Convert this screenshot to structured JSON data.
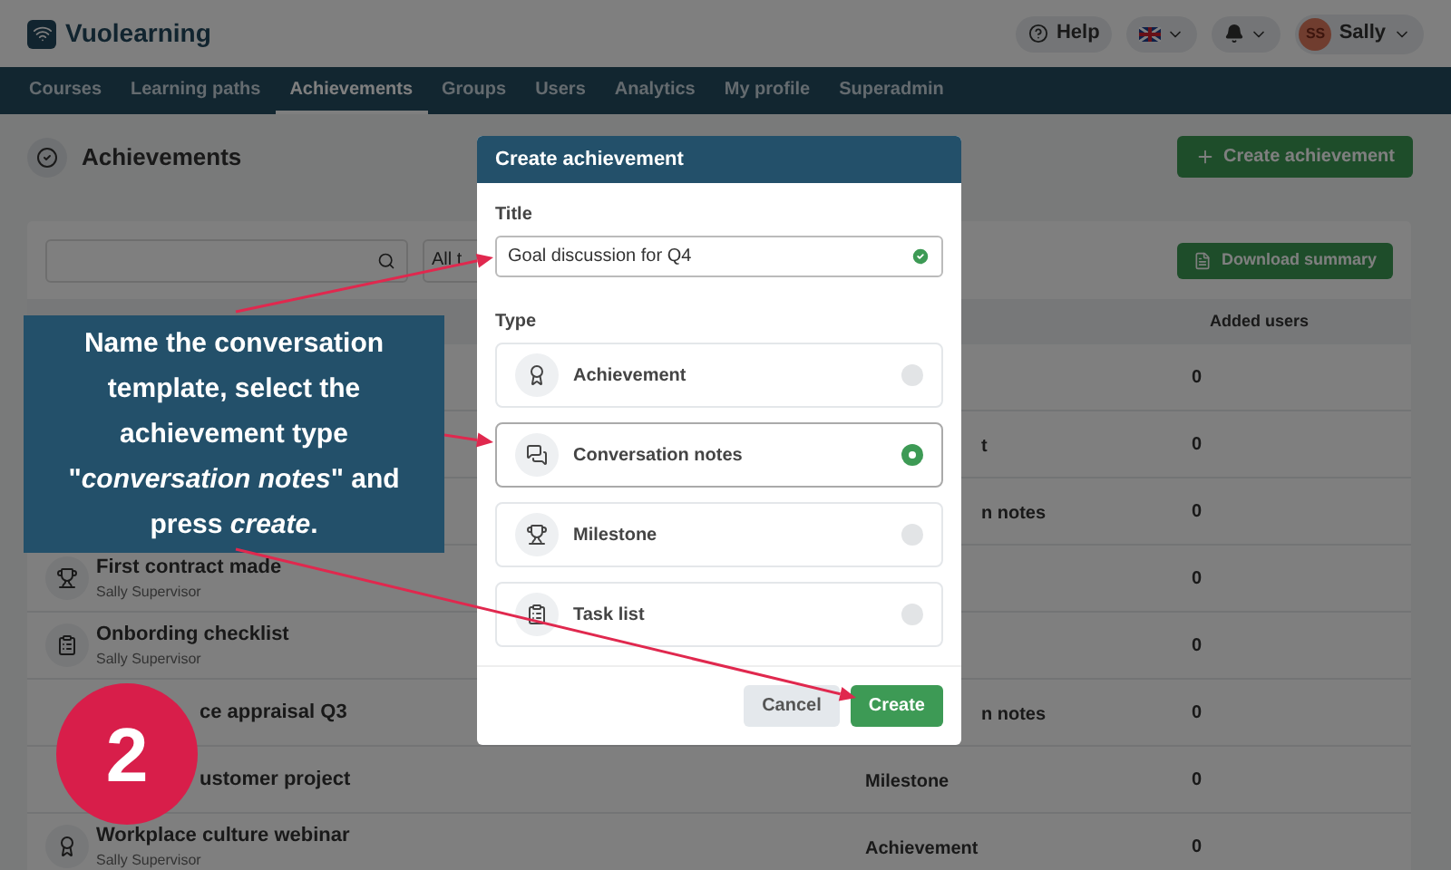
{
  "topbar": {
    "logo": "Vuolearning",
    "help": "Help",
    "user_initials": "SS",
    "user_name": "Sally"
  },
  "nav": [
    {
      "label": "Courses",
      "selected": false
    },
    {
      "label": "Learning paths",
      "selected": false
    },
    {
      "label": "Achievements",
      "selected": true
    },
    {
      "label": "Groups",
      "selected": false
    },
    {
      "label": "Users",
      "selected": false
    },
    {
      "label": "Analytics",
      "selected": false
    },
    {
      "label": "My profile",
      "selected": false
    },
    {
      "label": "Superadmin",
      "selected": false
    }
  ],
  "page": {
    "title": "Achievements",
    "create_button": "Create achievement"
  },
  "toolbar": {
    "type_filter": "All t",
    "download_button": "Download summary"
  },
  "table": {
    "columns": [
      "Added users"
    ],
    "rows": [
      {
        "kind": "blank",
        "users": "0"
      },
      {
        "kind": "blank",
        "type": "t",
        "type_cut": true,
        "users": "0"
      },
      {
        "kind": "blank",
        "type": "n notes",
        "type_cut": true,
        "users": "0"
      },
      {
        "kind": "trophy",
        "name": "First contract made",
        "owner": "Sally Supervisor",
        "users": "0"
      },
      {
        "kind": "clipboard",
        "name": "Onbording checklist",
        "owner": "Sally Supervisor",
        "users": "0"
      },
      {
        "kind": "cut",
        "name": "ce appraisal Q3",
        "type": "n notes",
        "type_cut": true,
        "users": "0"
      },
      {
        "kind": "cut",
        "name": "ustomer project",
        "type": "Milestone",
        "users": "0"
      },
      {
        "kind": "award",
        "name": "Workplace culture webinar",
        "owner": "Sally Supervisor",
        "type": "Achievement",
        "users": "0"
      }
    ]
  },
  "modal": {
    "title": "Create achievement",
    "title_label": "Title",
    "title_value": "Goal discussion for Q4",
    "title_valid": true,
    "type_label": "Type",
    "options": [
      {
        "kind": "award",
        "label": "Achievement",
        "selected": false
      },
      {
        "kind": "chat",
        "label": "Conversation notes",
        "selected": true
      },
      {
        "kind": "trophy",
        "label": "Milestone",
        "selected": false
      },
      {
        "kind": "clipboard",
        "label": "Task list",
        "selected": false
      }
    ],
    "cancel": "Cancel",
    "create": "Create"
  },
  "callout": {
    "text": "Name the conversation template, select the achievement type \"*conversation notes*\" and press *create*."
  },
  "step_number": "2"
}
